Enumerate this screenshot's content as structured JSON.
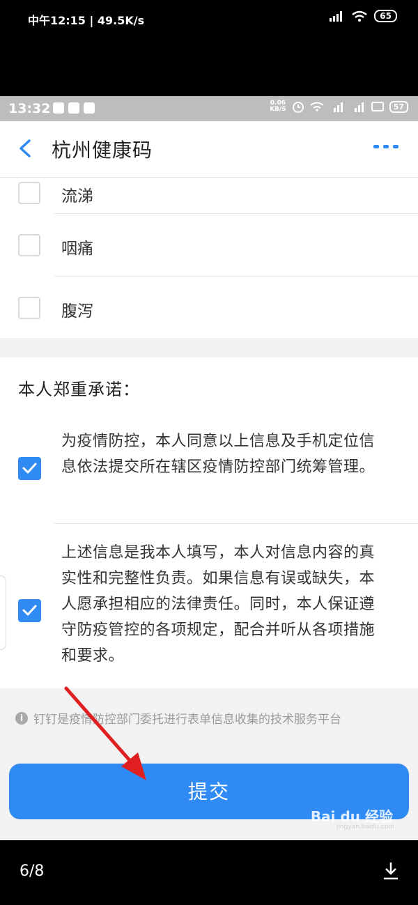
{
  "outer_status": {
    "time": "中午12:15 | 49.5K/s",
    "battery": "65"
  },
  "inner_status": {
    "time": "13:32",
    "speed_value": "0.06",
    "speed_unit": "KB/S",
    "battery": "57"
  },
  "navbar": {
    "back_icon": "chevron-left-icon",
    "title": "杭州健康码",
    "more_icon": "more-dots-icon"
  },
  "symptoms": [
    {
      "label": "流涕"
    },
    {
      "label": "咽痛"
    },
    {
      "label": "腹泻"
    }
  ],
  "promise": {
    "heading": "本人郑重承诺：",
    "items": [
      {
        "text": "为疫情防控，本人同意以上信息及手机定位信息依法提交所在辖区疫情防控部门统筹管理。",
        "checked": true
      },
      {
        "text": "上述信息是我本人填写，本人对信息内容的真实性和完整性负责。如果信息有误或缺失，本人愿承担相应的法律责任。同时，本人保证遵守防疫管控的各项规定，配合并听从各项措施和要求。",
        "checked": true
      }
    ]
  },
  "note": "钉钉是疫情防控部门委托进行表单信息收集的技术服务平台",
  "submit_label": "提交",
  "watermark": {
    "brand": "Bai du 经验",
    "url": "jingyan.baidu.com"
  },
  "footer": {
    "counter": "6/8",
    "download_icon": "download-icon"
  },
  "colors": {
    "accent": "#2f8bf3",
    "arrow": "#e02020"
  }
}
